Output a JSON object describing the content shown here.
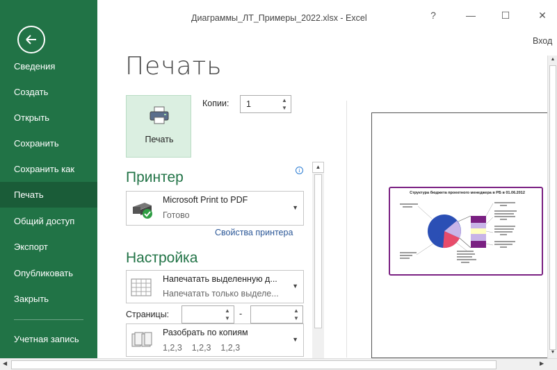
{
  "window": {
    "title": "Диаграммы_ЛТ_Примеры_2022.xlsx - Excel",
    "help": "?",
    "minimize": "—",
    "maximize": "☐",
    "close": "✕",
    "signin": "Вход"
  },
  "sidebar": {
    "items": [
      {
        "label": "Сведения"
      },
      {
        "label": "Создать"
      },
      {
        "label": "Открыть"
      },
      {
        "label": "Сохранить"
      },
      {
        "label": "Сохранить как"
      },
      {
        "label": "Печать",
        "active": true
      },
      {
        "label": "Общий доступ"
      },
      {
        "label": "Экспорт"
      },
      {
        "label": "Опубликовать"
      },
      {
        "label": "Закрыть"
      }
    ],
    "account": "Учетная запись"
  },
  "print": {
    "title": "Печать",
    "button_label": "Печать",
    "copies_label": "Копии:",
    "copies_value": "1"
  },
  "printer": {
    "header": "Принтер",
    "name": "Microsoft Print to PDF",
    "status": "Готово",
    "properties_link": "Свойства принтера"
  },
  "settings": {
    "header": "Настройка",
    "scope_main": "Напечатать выделенную д...",
    "scope_sub": "Напечатать только выделе...",
    "pages_label": "Страницы:",
    "pages_dash": "-",
    "collate_main": "Разобрать по копиям",
    "collate_sub": "1,2,3    1,2,3    1,2,3"
  },
  "preview": {
    "chart_title": "Структура бюджета проектного менеджера в РБ в 01.06.2012"
  },
  "colors": {
    "accent": "#217346",
    "active_nav": "#1a5c38",
    "link": "#2b5797",
    "chart_border": "#7a2082"
  }
}
